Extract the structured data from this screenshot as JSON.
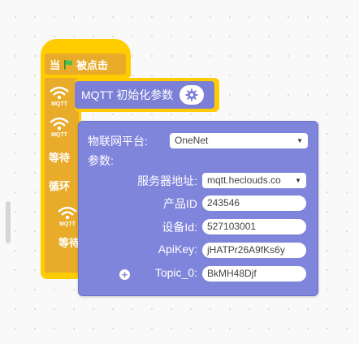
{
  "hat_block": {
    "label_when": "当",
    "label_clicked": "被点击",
    "flag_icon": "green-flag-icon"
  },
  "side_labels": {
    "wait_top": "等待",
    "loop": "循环",
    "wait_bottom": "等待"
  },
  "mqtt_block": {
    "label": "MQTT 初始化参数",
    "gear_icon": "gear-icon",
    "wifi_icon": "wifi-mqtt-icon"
  },
  "panel": {
    "platform_label": "物联网平台:",
    "platform_value": "OneNet",
    "params_label": "参数:",
    "server_label": "服务器地址:",
    "server_value": "mqtt.heclouds.co",
    "product_label": "产品ID",
    "product_value": "243546",
    "device_label": "设备Id:",
    "device_value": "527103001",
    "apikey_label": "ApiKey:",
    "apikey_value": "jHATPr26A9fKs6y",
    "topic_label": "Topic_0:",
    "topic_value": "BkMH48Djf",
    "add_icon": "plus-circle-icon"
  },
  "colors": {
    "block_yellow": "#ffcc00",
    "block_yellow_dark": "#e8ab2a",
    "mqtt_purple": "#7b7fd6",
    "panel_purple": "#8085dc"
  }
}
